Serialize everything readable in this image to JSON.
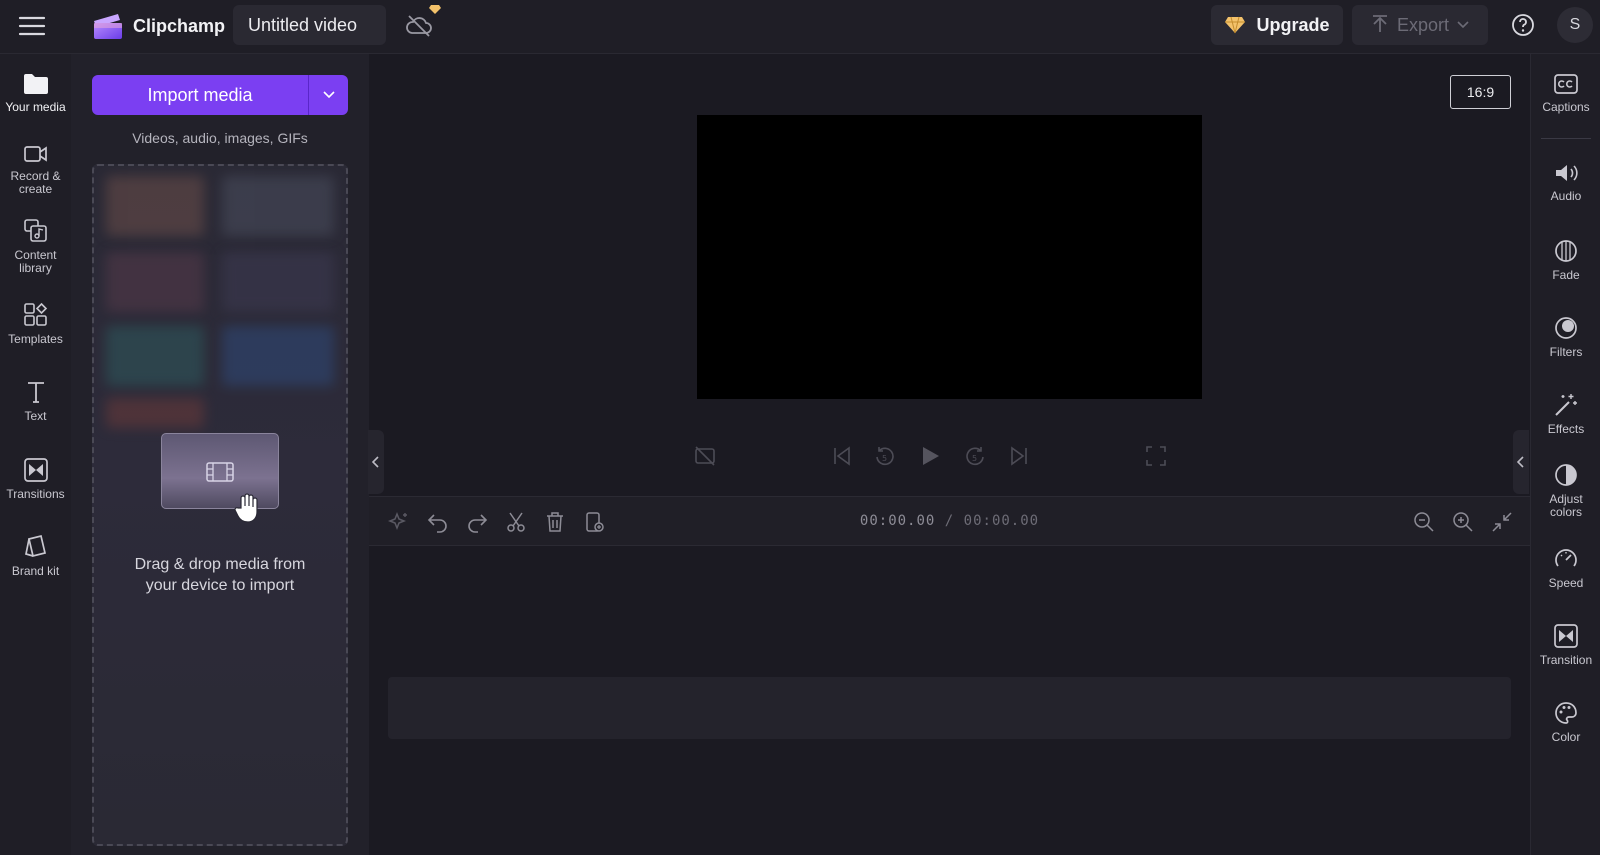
{
  "app": {
    "name": "Clipchamp",
    "video_title": "Untitled video"
  },
  "header": {
    "upgrade_label": "Upgrade",
    "export_label": "Export",
    "avatar_initial": "S",
    "colors": {
      "upgrade_gem": "#f3c26b",
      "brand_purple": "#7b3ff2"
    }
  },
  "leftnav": {
    "items": [
      {
        "id": "your-media",
        "label_lines": [
          "Your media"
        ],
        "icon": "folder-icon",
        "active": true
      },
      {
        "id": "record-create",
        "label_lines": [
          "Record &",
          "create"
        ],
        "icon": "camera-icon"
      },
      {
        "id": "content-library",
        "label_lines": [
          "Content",
          "library"
        ],
        "icon": "library-icon"
      },
      {
        "id": "templates",
        "label_lines": [
          "Templates"
        ],
        "icon": "templates-icon"
      },
      {
        "id": "text",
        "label_lines": [
          "Text"
        ],
        "icon": "text-icon"
      },
      {
        "id": "transitions",
        "label_lines": [
          "Transitions"
        ],
        "icon": "transitions-icon"
      },
      {
        "id": "brand-kit",
        "label_lines": [
          "Brand kit"
        ],
        "icon": "brand-kit-icon"
      }
    ]
  },
  "media": {
    "import_label": "Import media",
    "hint": "Videos, audio, images, GIFs",
    "drop_line1": "Drag & drop media from",
    "drop_line2": "your device to import"
  },
  "preview": {
    "aspect_ratio": "16:9"
  },
  "timeline": {
    "current_time": "00:00.00",
    "separator": "/",
    "total_time": "00:00.00"
  },
  "rightnav": {
    "items": [
      {
        "id": "captions",
        "label_lines": [
          "Captions"
        ],
        "icon": "captions-icon"
      },
      {
        "id": "audio",
        "label_lines": [
          "Audio"
        ],
        "icon": "speaker-icon"
      },
      {
        "id": "fade",
        "label_lines": [
          "Fade"
        ],
        "icon": "fade-icon"
      },
      {
        "id": "filters",
        "label_lines": [
          "Filters"
        ],
        "icon": "filters-icon"
      },
      {
        "id": "effects",
        "label_lines": [
          "Effects"
        ],
        "icon": "magic-wand-icon"
      },
      {
        "id": "adjust-colors",
        "label_lines": [
          "Adjust",
          "colors"
        ],
        "icon": "contrast-icon"
      },
      {
        "id": "speed",
        "label_lines": [
          "Speed"
        ],
        "icon": "speedometer-icon"
      },
      {
        "id": "transition",
        "label_lines": [
          "Transition"
        ],
        "icon": "transition-icon"
      },
      {
        "id": "color",
        "label_lines": [
          "Color"
        ],
        "icon": "palette-icon"
      }
    ]
  }
}
